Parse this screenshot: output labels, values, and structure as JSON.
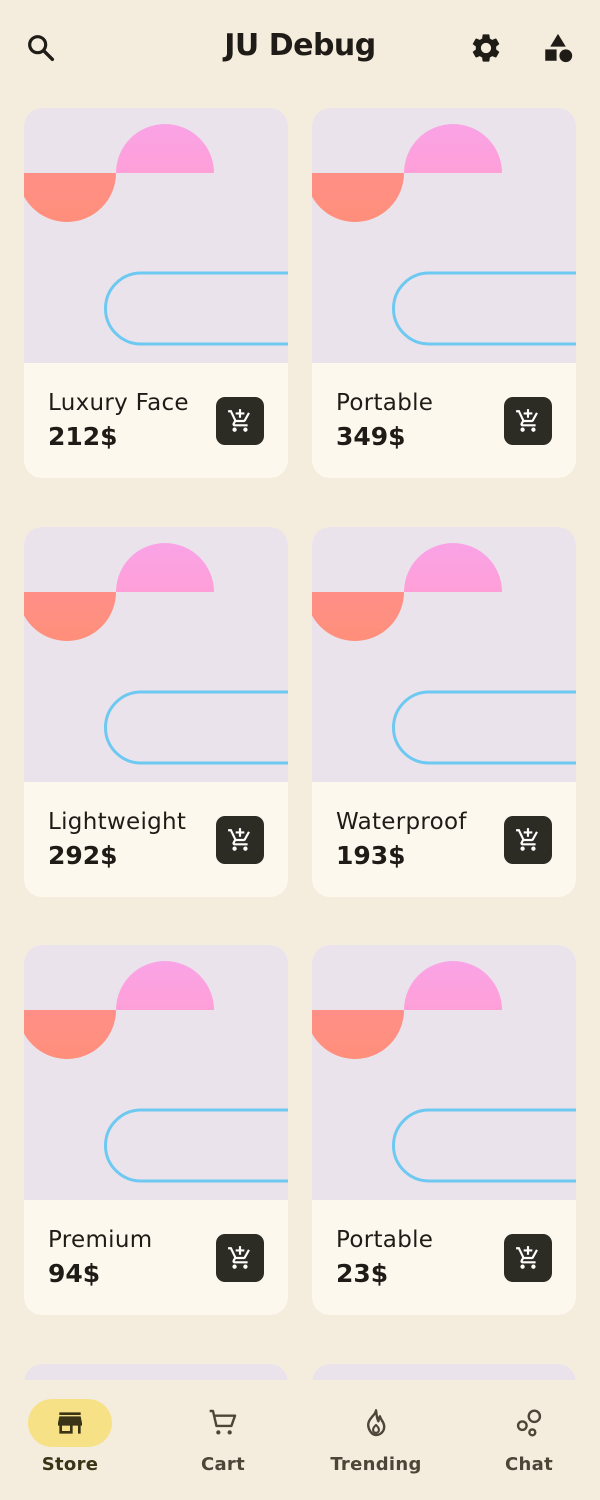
{
  "app": {
    "title": "JU Debug"
  },
  "topbar": {
    "icons": [
      "search-icon",
      "settings-gear-icon",
      "category-shapes-icon"
    ]
  },
  "products": [
    {
      "name": "Luxury Face",
      "price": "212$"
    },
    {
      "name": "Portable",
      "price": "349$"
    },
    {
      "name": "Lightweight",
      "price": "292$"
    },
    {
      "name": "Waterproof",
      "price": "193$"
    },
    {
      "name": "Premium",
      "price": "94$"
    },
    {
      "name": "Portable",
      "price": "23$"
    }
  ],
  "navbar": {
    "items": [
      {
        "label": "Store",
        "icon": "store-icon",
        "active": true
      },
      {
        "label": "Cart",
        "icon": "cart-icon",
        "active": false
      },
      {
        "label": "Trending",
        "icon": "trending-flame-icon",
        "active": false
      },
      {
        "label": "Chat",
        "icon": "chat-bubbles-icon",
        "active": false
      }
    ]
  },
  "colors": {
    "background": "#f4ecdd",
    "card_art_bg": "#ebe3eb",
    "card_info_bg": "#fdf8ee",
    "cart_button": "#2c2b24",
    "nav_active_pill": "#f7e187",
    "shape_pink": "#f9a3e6",
    "shape_coral": "#ff8a80",
    "shape_outline": "#6ec9f2"
  }
}
